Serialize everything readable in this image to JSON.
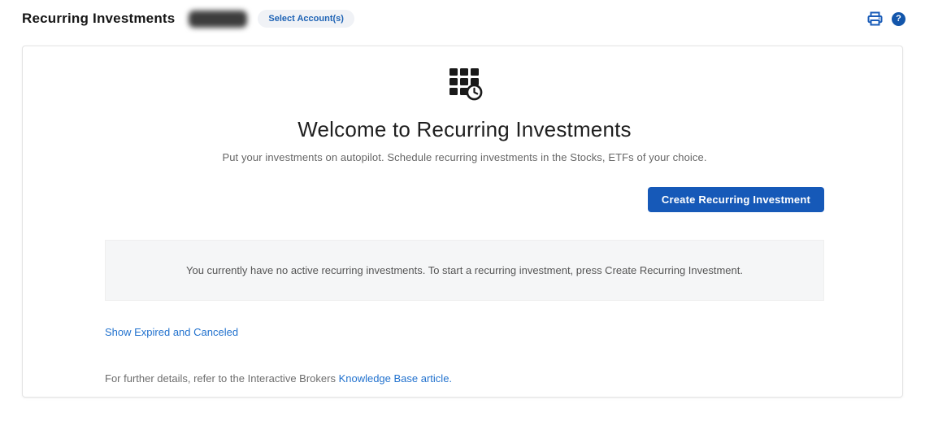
{
  "header": {
    "title": "Recurring Investments",
    "select_accounts_label": "Select Account(s)",
    "icons": {
      "print": "printer-icon",
      "help": "question-mark-help-icon"
    },
    "help_glyph": "?"
  },
  "main": {
    "hero_icon": "recurring-schedule-grid-clock-icon",
    "heading": "Welcome to Recurring Investments",
    "subtitle": "Put your investments on autopilot. Schedule recurring investments in the Stocks, ETFs of your choice.",
    "create_button_label": "Create Recurring Investment",
    "notice_text": "You currently have no active recurring investments. To start a recurring investment, press Create Recurring Investment.",
    "show_expired_link": "Show Expired and Canceled",
    "footer_text_prefix": "For further details, refer to the Interactive Brokers ",
    "footer_link_text": "Knowledge Base article."
  },
  "colors": {
    "primary_button_blue": "#1659b8",
    "link_blue": "#2272ce",
    "icon_blue": "#1a5cb8",
    "help_circle_blue": "#1356ab",
    "notice_background": "#f5f6f7",
    "card_border": "#e3e3e3"
  }
}
